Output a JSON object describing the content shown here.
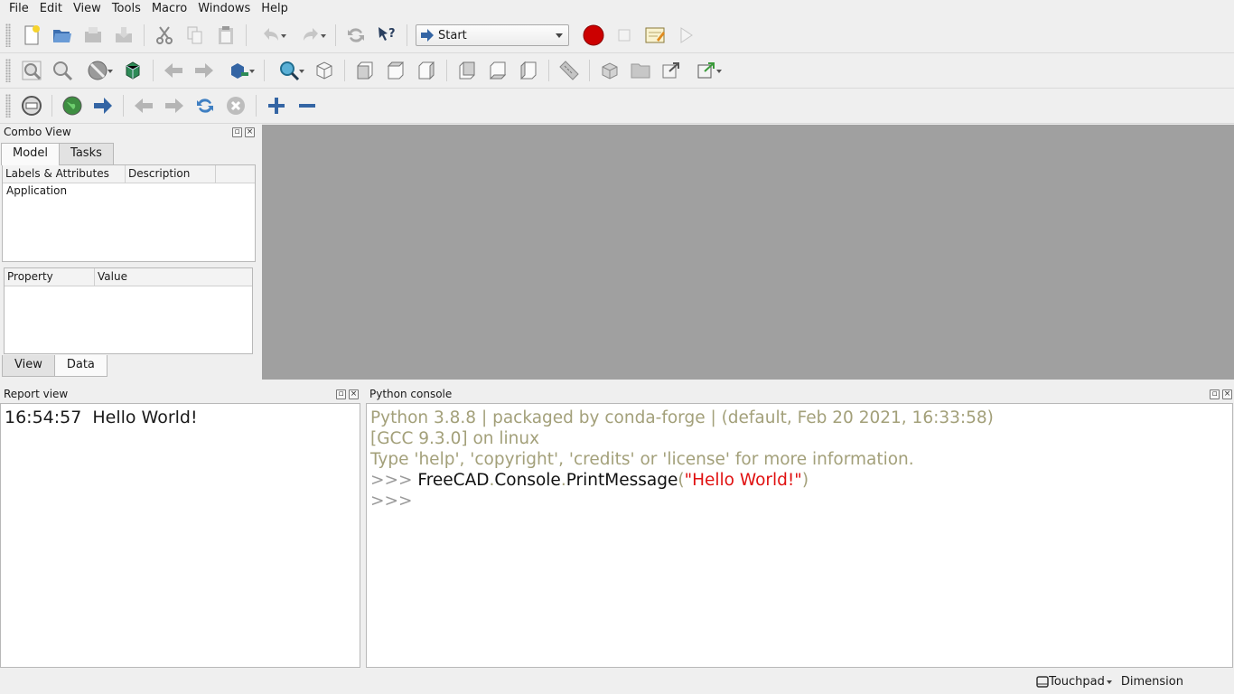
{
  "menu": [
    "File",
    "Edit",
    "View",
    "Tools",
    "Macro",
    "Windows",
    "Help"
  ],
  "toolbar": {
    "workbench_selected": "Start"
  },
  "combo_view": {
    "title": "Combo View",
    "tabs": [
      "Model",
      "Tasks"
    ],
    "tree_columns": [
      "Labels & Attributes",
      "Description"
    ],
    "tree_items": [
      "Application"
    ],
    "property_columns": [
      "Property",
      "Value"
    ],
    "bottom_tabs": [
      "View",
      "Data"
    ]
  },
  "report_view": {
    "title": "Report view",
    "timestamp": "16:54:57",
    "message": "Hello World!"
  },
  "python_console": {
    "title": "Python console",
    "line1": "Python 3.8.8 | packaged by conda-forge | (default, Feb 20 2021, 16:33:58)",
    "line2": "[GCC 9.3.0] on linux",
    "line3": "Type 'help', 'copyright', 'credits' or 'license' for more information.",
    "prompt": ">>>",
    "cmd_obj1": "FreeCAD",
    "dot": ".",
    "cmd_obj2": "Console",
    "cmd_fn": "PrintMessage",
    "paren_open": "(",
    "cmd_arg": "\"Hello World!\"",
    "paren_close": ")"
  },
  "status": {
    "nav_style": "Touchpad",
    "units": "Dimension"
  }
}
